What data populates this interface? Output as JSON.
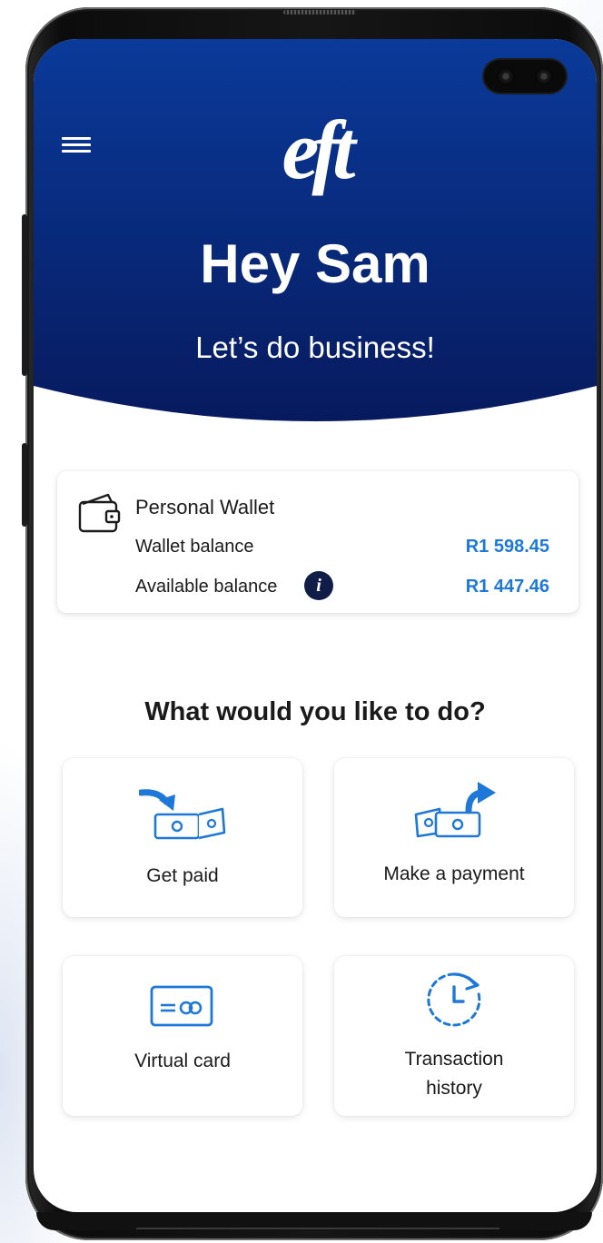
{
  "header": {
    "logo_text": "eft",
    "greeting": "Hey Sam",
    "tagline": "Let’s do business!"
  },
  "wallet": {
    "title": "Personal Wallet",
    "wallet_balance_label": "Wallet balance",
    "wallet_balance_value": "R1 598.45",
    "available_balance_label": "Available balance",
    "available_balance_value": "R1 447.46",
    "info_glyph": "i"
  },
  "actions": {
    "title": "What would you like to do?",
    "items": [
      {
        "label": "Get paid",
        "icon": "receive-money-icon"
      },
      {
        "label": "Make a payment",
        "icon": "send-money-icon"
      },
      {
        "label": "Virtual card",
        "icon": "card-icon"
      },
      {
        "label_line1": "Transaction",
        "label_line2": "history",
        "icon": "history-clock-icon"
      }
    ]
  },
  "colors": {
    "hero_top": "#0a3a9a",
    "hero_bottom": "#071a5e",
    "accent_blue": "#1e78d8",
    "text_dark": "#1a1a1a",
    "info_bg": "#0f1d48"
  }
}
